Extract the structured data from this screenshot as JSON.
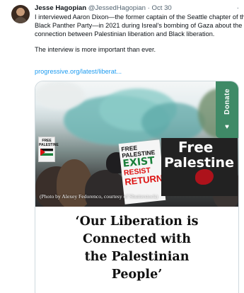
{
  "tweet": {
    "author_name": "Jesse Hagopian",
    "author_handle": "@JessedHagopian",
    "separator": "·",
    "date": "Oct 30",
    "more_icon": "more-horizontal-icon",
    "text_lines": [
      "I interviewed Aaron Dixon—the former captain of the Seattle chapter of th",
      "Black Panther Party—in 2021 during Isreal's bombing of Gaza about the",
      "connection between Palestinian liberation and Black liberation."
    ],
    "text_line_2": "The interview is more important than ever.",
    "link": "progressive.org/latest/liberat..."
  },
  "card": {
    "photo": {
      "sign_small": "FREE PALESTINE",
      "sign_white_lines": [
        "FREE PALESTINE",
        "EXIST",
        "RESIST",
        "RETURN"
      ],
      "sign_black_lines": [
        "Free",
        "Palestine"
      ],
      "credit": "(Photo by Alexey Fedorenco, courtesy of Shutterstock)"
    },
    "donate_label": "Donate",
    "donate_icon": "heart-icon",
    "headline_lines": [
      "‘Our Liberation is",
      "Connected with",
      "the Palestinian",
      "People’"
    ]
  }
}
